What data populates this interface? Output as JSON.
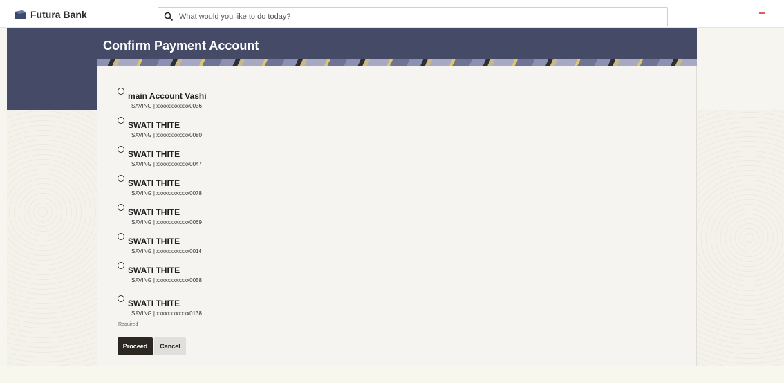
{
  "app": {
    "brand": "Futura Bank",
    "logo_icon": "bank-logo-icon"
  },
  "search": {
    "placeholder": "What would you like to do today?",
    "icon": "search-icon"
  },
  "page": {
    "title": "Confirm Payment Account"
  },
  "accounts": [
    {
      "name": "main Account Vashi",
      "detail": "SAVING | xxxxxxxxxxxx0036"
    },
    {
      "name": "SWATI THITE",
      "detail": "SAVING | xxxxxxxxxxxx0080"
    },
    {
      "name": "SWATI THITE",
      "detail": "SAVING | xxxxxxxxxxxx0047"
    },
    {
      "name": "SWATI THITE",
      "detail": "SAVING | xxxxxxxxxxxx0078"
    },
    {
      "name": "SWATI THITE",
      "detail": "SAVING | xxxxxxxxxxxx0069"
    },
    {
      "name": "SWATI THITE",
      "detail": "SAVING | xxxxxxxxxxxx0014"
    },
    {
      "name": "SWATI THITE",
      "detail": "SAVING | xxxxxxxxxxxx0058"
    },
    {
      "name": "SWATI THITE",
      "detail": "SAVING | xxxxxxxxxxxx0138"
    }
  ],
  "form": {
    "required_text": "Required"
  },
  "actions": {
    "proceed_label": "Proceed",
    "cancel_label": "Cancel"
  },
  "colors": {
    "header_band": "#454a66",
    "primary_button": "#2c2723",
    "secondary_button": "#e1dfdb"
  }
}
